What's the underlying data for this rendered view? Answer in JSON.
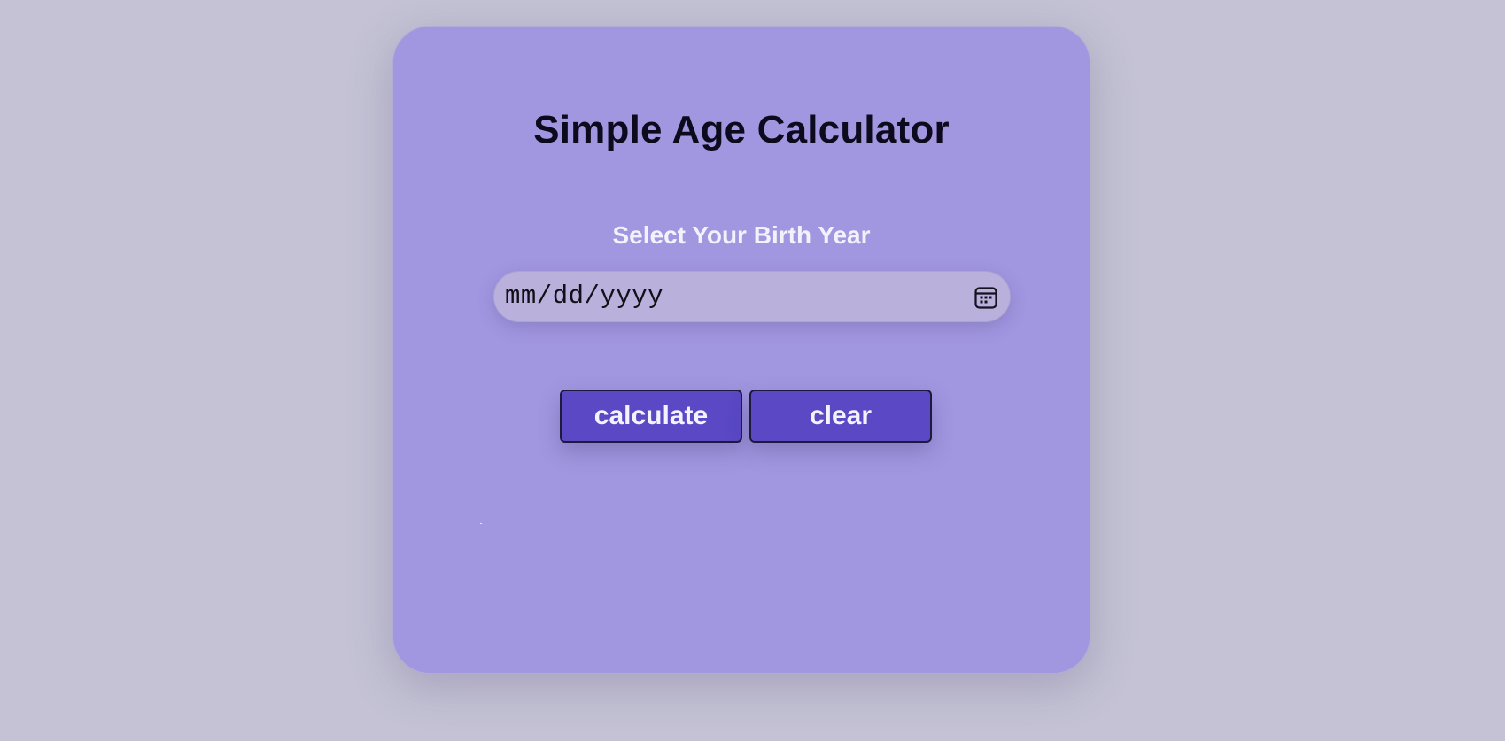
{
  "app": {
    "title": "Simple Age Calculator"
  },
  "form": {
    "label": "Select Your Birth Year",
    "date_placeholder": "mm/dd/yyyy",
    "date_value": ""
  },
  "buttons": {
    "calculate_label": "calculate",
    "clear_label": "clear"
  },
  "icons": {
    "date_picker": "calendar-icon"
  },
  "colors": {
    "page_background": "#c4c2d4",
    "card_background": "#a196e0",
    "input_background": "#b9b0dc",
    "button_background": "#5a48c4",
    "title_text": "#0e0a1e",
    "label_text": "#f3f1fb"
  }
}
